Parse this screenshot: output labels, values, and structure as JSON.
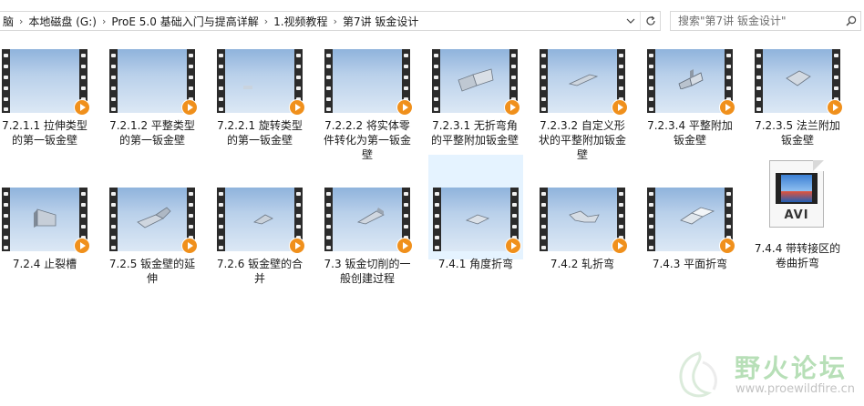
{
  "breadcrumb": {
    "items": [
      "脑",
      "本地磁盘 (G:)",
      "ProE 5.0 基础入门与提高详解",
      "1.视频教程",
      "第7讲 钣金设计"
    ],
    "separator": "›"
  },
  "search": {
    "placeholder": "搜索\"第7讲 钣金设计\""
  },
  "icons": {
    "breadcrumb_dropdown": "chevron-down-icon",
    "refresh": "refresh-icon",
    "search": "search-icon",
    "play": "play-badge-icon"
  },
  "files": [
    {
      "name": "7.2.1.1 拉伸类型的第一钣金壁",
      "type": "video"
    },
    {
      "name": "7.2.1.2 平整类型的第一钣金壁",
      "type": "video"
    },
    {
      "name": "7.2.2.1 旋转类型的第一钣金壁",
      "type": "video"
    },
    {
      "name": "7.2.2.2 将实体零件转化为第一钣金壁",
      "type": "video"
    },
    {
      "name": "7.2.3.1 无折弯角的平整附加钣金壁",
      "type": "video"
    },
    {
      "name": "7.2.3.2 自定义形状的平整附加钣金壁",
      "type": "video"
    },
    {
      "name": "7.2.3.4 平整附加钣金壁",
      "type": "video"
    },
    {
      "name": "7.2.3.5 法兰附加钣金壁",
      "type": "video"
    },
    {
      "name": "7.2.4 止裂槽",
      "type": "video"
    },
    {
      "name": "7.2.5 钣金壁的延伸",
      "type": "video"
    },
    {
      "name": "7.2.6 钣金壁的合并",
      "type": "video"
    },
    {
      "name": "7.3 钣金切削的一般创建过程",
      "type": "video"
    },
    {
      "name": "7.4.1 角度折弯",
      "type": "video",
      "selected": true
    },
    {
      "name": "7.4.2 轧折弯",
      "type": "video"
    },
    {
      "name": "7.4.3 平面折弯",
      "type": "video"
    },
    {
      "name": "7.4.4 带转接区的卷曲折弯",
      "type": "avi",
      "badge": "AVI"
    }
  ],
  "watermark": {
    "title": "野火论坛",
    "url": "www.proewildfire.cn"
  },
  "colors": {
    "selection": "#e5f3ff",
    "play_badge": "#f0901c",
    "thumb_sky": "#b9d0ea"
  }
}
